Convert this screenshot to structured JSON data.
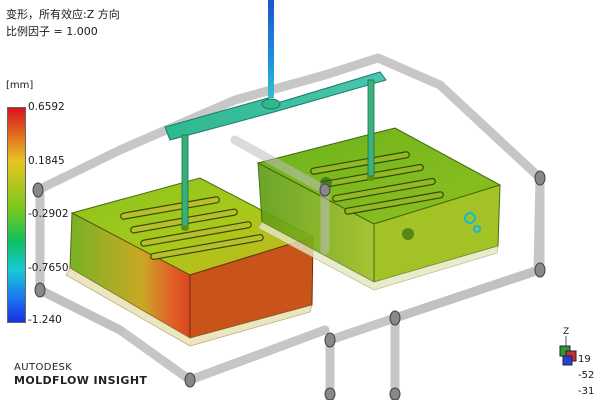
{
  "header": {
    "line1": "变形，所有效应:Z 方向",
    "line2": "比例因子 = 1.000"
  },
  "legend": {
    "unit": "[mm]",
    "ticks": [
      "0.6592",
      "0.1845",
      "-0.2902",
      "-0.7650",
      "-1.240"
    ],
    "max_color": "#d8141e",
    "min_color": "#1a2fe0"
  },
  "brand": {
    "line1": "AUTODESK",
    "line2": "MOLDFLOW INSIGHT"
  },
  "triad": {
    "axis_label": "Z",
    "readouts": [
      "19",
      "-52",
      "-31"
    ]
  },
  "colors": {
    "part_green": "#7bbf20",
    "part_hot": "#d8461a",
    "runner_cyan": "#3fc8b8",
    "cooling_gray": "#bdbdbd"
  }
}
